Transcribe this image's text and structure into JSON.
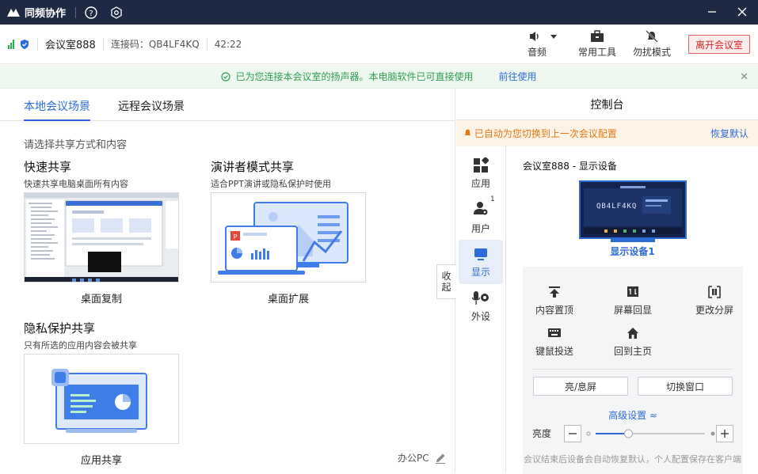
{
  "titlebar": {
    "app_name": "同频协作"
  },
  "toolbar": {
    "room_name": "会议室888",
    "connect_code": "连接码：QB4LF4KQ",
    "elapsed": "42:22",
    "sound_label": "音频",
    "tools_label": "常用工具",
    "dnd_label": "勿扰模式",
    "leave_label": "离开会议室"
  },
  "notice": {
    "message": "已为您连接本会议室的扬声器。本电脑软件已可直接使用",
    "link": "前往使用"
  },
  "left": {
    "tabs": [
      "本地会议场景",
      "远程会议场景"
    ],
    "hint": "请选择共享方式和内容",
    "cards": [
      {
        "title": "快速共享",
        "desc": "快速共享电脑桌面所有内容",
        "label": "桌面复制"
      },
      {
        "title": "演讲者模式共享",
        "desc": "适合PPT演讲或隐私保护时使用",
        "label": "桌面扩展"
      },
      {
        "title": "隐私保护共享",
        "desc": "只有所选的应用内容会被共享",
        "label": "应用共享"
      }
    ],
    "collapse_label": "收起",
    "device_name": "办公PC"
  },
  "right": {
    "title": "控制台",
    "restore_msg": "已自动为您切换到上一次会议配置",
    "restore_btn": "恢复默认",
    "side": [
      {
        "label": "应用",
        "icon": "apps-icon"
      },
      {
        "label": "用户",
        "icon": "user-icon",
        "badge": "1"
      },
      {
        "label": "显示",
        "icon": "monitor-icon"
      },
      {
        "label": "外设",
        "icon": "peripheral-icon"
      }
    ],
    "panel_title": "会议室888 - 显示设备",
    "screen_code": "QB4LF4KQ",
    "device_label": "显示设备1",
    "actions": [
      "内容置顶",
      "屏幕回显",
      "更改分屏",
      "键鼠投送",
      "回到主页"
    ],
    "buttons": [
      "亮/息屏",
      "切换窗口"
    ],
    "advanced": "高级设置 ≈",
    "brightness_label": "亮度",
    "brightness_level": 0.3,
    "footer": "会议结束后设备会自动恢复默认，个人配置保存在客户端"
  },
  "colors": {
    "accent": "#2c6cd6",
    "titlebar": "#1e2a44",
    "danger": "#d62424",
    "success": "#2f9e4f",
    "warning": "#e27a14"
  }
}
